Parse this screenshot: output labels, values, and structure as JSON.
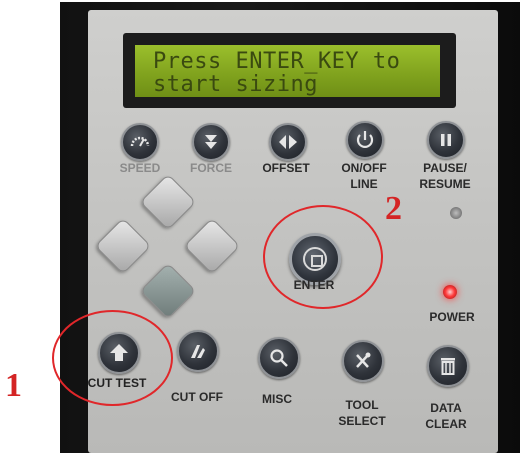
{
  "lcd": {
    "line1": "Press ENTER_KEY to",
    "line2": "start sizing"
  },
  "buttons": {
    "speed": "SPEED",
    "force": "FORCE",
    "offset": "OFFSET",
    "on_off_line": "ON/OFF\nLINE",
    "pause_resume": "PAUSE/\nRESUME",
    "enter": "ENTER",
    "power": "POWER",
    "cut_test": "CUT TEST",
    "cut_off": "CUT OFF",
    "misc": "MISC",
    "tool_select": "TOOL\nSELECT",
    "data_clear": "DATA\nCLEAR"
  },
  "annotations": {
    "marker_1": "1",
    "marker_2": "2",
    "color": "#d42424"
  },
  "leds": {
    "status_color": "#7d7d7d",
    "power_color": "#ff3b3b"
  }
}
